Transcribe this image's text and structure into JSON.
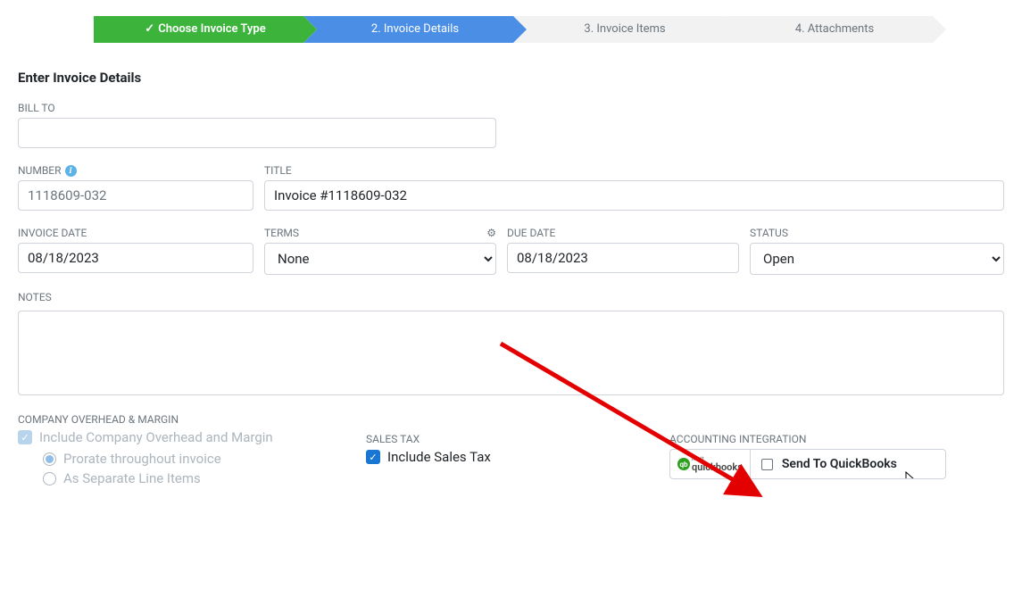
{
  "stepper": {
    "steps": [
      {
        "label": "Choose Invoice Type",
        "state": "completed"
      },
      {
        "label": "2. Invoice Details",
        "state": "active"
      },
      {
        "label": "3. Invoice Items",
        "state": "pending"
      },
      {
        "label": "4. Attachments",
        "state": "pending"
      }
    ]
  },
  "page": {
    "title": "Enter Invoice Details"
  },
  "fields": {
    "billto_label": "BILL TO",
    "billto_value": "",
    "number_label": "NUMBER",
    "number_value": "1118609-032",
    "title_label": "TITLE",
    "title_value": "Invoice #1118609-032",
    "invdate_label": "INVOICE DATE",
    "invdate_value": "08/18/2023",
    "terms_label": "TERMS",
    "terms_value": "None",
    "duedate_label": "DUE DATE",
    "duedate_value": "08/18/2023",
    "status_label": "STATUS",
    "status_value": "Open",
    "notes_label": "NOTES",
    "notes_value": ""
  },
  "overhead": {
    "section_label": "COMPANY OVERHEAD & MARGIN",
    "include_label": "Include Company Overhead and Margin",
    "prorate_label": "Prorate throughout invoice",
    "separate_label": "As Separate Line Items"
  },
  "salestax": {
    "section_label": "SALES TAX",
    "include_label": "Include Sales Tax"
  },
  "integration": {
    "section_label": "ACCOUNTING INTEGRATION",
    "logo_small": "intuit",
    "logo_big": "quickbooks",
    "send_label": "Send To QuickBooks"
  }
}
